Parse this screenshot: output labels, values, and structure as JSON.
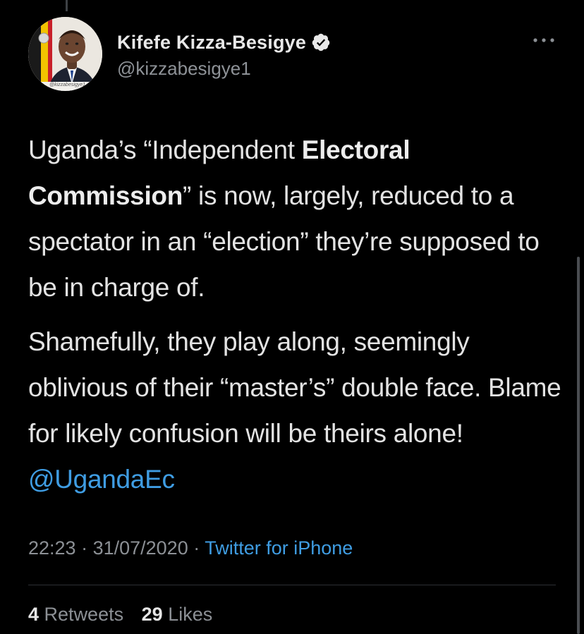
{
  "author": {
    "display_name": "Kifefe Kizza-Besigye",
    "handle": "@kizzabesigye1",
    "verified": true,
    "avatar_watermark": "@kizzabesigye1"
  },
  "tweet": {
    "paragraph1": {
      "part1": "Uganda’s “Independent ",
      "bold1": "Electoral",
      "space": " ",
      "bold2": "Commission",
      "part2": "” is now, largely, reduced to a spectator in an “election” they’re supposed to be in charge of."
    },
    "paragraph2": {
      "text": "Shamefully, they play along, seemingly oblivious of their “master’s” double face. Blame for likely confusion will be theirs alone! ",
      "mention": "@UgandaEc"
    }
  },
  "meta": {
    "time": "22:23",
    "separator": " · ",
    "date": "31/07/2020",
    "source": "Twitter for iPhone"
  },
  "stats": {
    "retweets_count": "4",
    "retweets_label": "Retweets",
    "likes_count": "29",
    "likes_label": "Likes"
  },
  "colors": {
    "background": "#000000",
    "link": "#3f9de3",
    "secondary_text": "#8c9095",
    "primary_text": "#e3e3e3"
  },
  "icons": {
    "verified": "verified-badge-icon",
    "more": "more-options-icon"
  }
}
